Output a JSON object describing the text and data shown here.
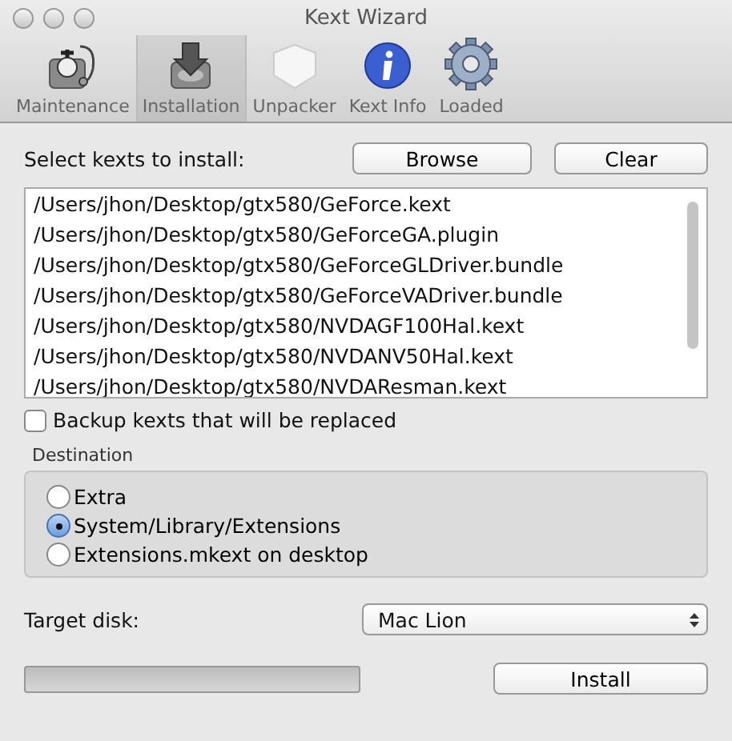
{
  "window": {
    "title": "Kext Wizard"
  },
  "toolbar": [
    {
      "label": "Maintenance",
      "kind": "doctor",
      "selected": false
    },
    {
      "label": "Installation",
      "kind": "install",
      "selected": true
    },
    {
      "label": "Unpacker",
      "kind": "unpack",
      "selected": false
    },
    {
      "label": "Kext Info",
      "kind": "info",
      "selected": false
    },
    {
      "label": "Loaded",
      "kind": "gear",
      "selected": false
    }
  ],
  "select_label": "Select kexts to install:",
  "buttons": [
    "Browse",
    "Clear"
  ],
  "kext_list": [
    "/Users/jhon/Desktop/gtx580/GeForce.kext",
    "/Users/jhon/Desktop/gtx580/GeForceGA.plugin",
    "/Users/jhon/Desktop/gtx580/GeForceGLDriver.bundle",
    "/Users/jhon/Desktop/gtx580/GeForceVADriver.bundle",
    "/Users/jhon/Desktop/gtx580/NVDAGF100Hal.kext",
    "/Users/jhon/Desktop/gtx580/NVDANV50Hal.kext",
    "/Users/jhon/Desktop/gtx580/NVDAResman.kext"
  ],
  "backup": {
    "label": "Backup kexts that will be replaced",
    "checked": false
  },
  "destination": {
    "title": "Destination",
    "options": [
      {
        "label": "Extra",
        "selected": false
      },
      {
        "label": "System/Library/Extensions",
        "selected": true
      },
      {
        "label": "Extensions.mkext on desktop",
        "selected": false
      }
    ]
  },
  "target_disk": {
    "label": "Target disk:",
    "value": "Mac Lion"
  },
  "progress": {
    "level": 0
  },
  "install_button": "Install"
}
